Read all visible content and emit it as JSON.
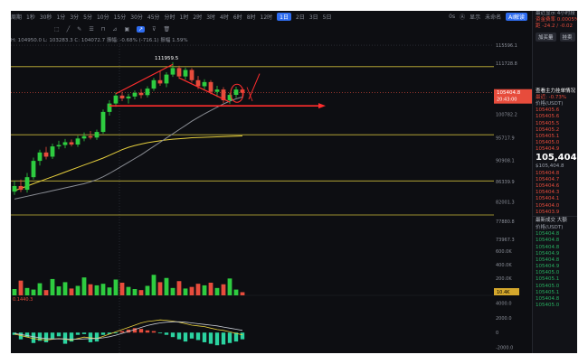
{
  "toolbar": {
    "items": [
      "周期",
      "1秒",
      "30秒",
      "1分",
      "3分",
      "5分",
      "10分",
      "15分",
      "30分",
      "45分",
      "分时",
      "1时",
      "2时",
      "3时",
      "4时",
      "6时",
      "8时",
      "12时",
      "1日",
      "2日",
      "3日",
      "5日"
    ],
    "active_index": 18,
    "right": [
      "0s",
      "Ⓐ",
      "显示",
      "未命名",
      "AI解读"
    ]
  },
  "indicator_info": {
    "text": "H: 104950.0  L: 103283.3  C: 104072.7  振幅: -0.68% (-716.1)  振幅 1.59%"
  },
  "macd_info": {
    "label": "0.1440.3"
  },
  "chart_data": {
    "type": "candlestick",
    "title": "",
    "ylim": [
      73000,
      116000
    ],
    "price_ticks": [
      "115596.1",
      "111728.8",
      "105404.8",
      "100782.2",
      "95717.9",
      "90908.1",
      "86339.9",
      "82001.3",
      "77880.8",
      "73967.3"
    ],
    "price_tick_values": [
      115596.1,
      111728.8,
      105404.8,
      100782.2,
      95717.9,
      90908.1,
      86339.9,
      82001.3,
      77880.8,
      73967.3
    ],
    "last_price": "105404.8",
    "countdown": "20:43:00",
    "peak_label": "111959.5",
    "peak_value": 111959.5,
    "horizontal_levels": [
      111000,
      96400,
      86500,
      79200
    ],
    "candles": [
      {
        "o": 84200,
        "h": 86500,
        "l": 83500,
        "c": 85400
      },
      {
        "o": 85400,
        "h": 86800,
        "l": 84100,
        "c": 84600
      },
      {
        "o": 84600,
        "h": 88200,
        "l": 84000,
        "c": 87300
      },
      {
        "o": 87300,
        "h": 91500,
        "l": 86800,
        "c": 90800
      },
      {
        "o": 90800,
        "h": 93200,
        "l": 89800,
        "c": 92600
      },
      {
        "o": 92600,
        "h": 93800,
        "l": 91100,
        "c": 91700
      },
      {
        "o": 91700,
        "h": 94500,
        "l": 91200,
        "c": 93900
      },
      {
        "o": 93900,
        "h": 95100,
        "l": 93300,
        "c": 94200
      },
      {
        "o": 94200,
        "h": 95500,
        "l": 93500,
        "c": 94800
      },
      {
        "o": 94800,
        "h": 95400,
        "l": 93900,
        "c": 94300
      },
      {
        "o": 94300,
        "h": 96200,
        "l": 93800,
        "c": 95600
      },
      {
        "o": 95600,
        "h": 96900,
        "l": 95000,
        "c": 96100
      },
      {
        "o": 96100,
        "h": 97200,
        "l": 95400,
        "c": 95800
      },
      {
        "o": 95800,
        "h": 97500,
        "l": 95300,
        "c": 97000
      },
      {
        "o": 97000,
        "h": 101800,
        "l": 96600,
        "c": 101300
      },
      {
        "o": 101300,
        "h": 103800,
        "l": 100500,
        "c": 103100
      },
      {
        "o": 103100,
        "h": 105500,
        "l": 102400,
        "c": 104800
      },
      {
        "o": 104800,
        "h": 105600,
        "l": 103600,
        "c": 104200
      },
      {
        "o": 104200,
        "h": 105200,
        "l": 103100,
        "c": 104600
      },
      {
        "o": 104600,
        "h": 105900,
        "l": 104000,
        "c": 105400
      },
      {
        "o": 105400,
        "h": 106200,
        "l": 104200,
        "c": 104900
      },
      {
        "o": 104900,
        "h": 106800,
        "l": 104400,
        "c": 106300
      },
      {
        "o": 106300,
        "h": 108600,
        "l": 105800,
        "c": 108100
      },
      {
        "o": 108100,
        "h": 110200,
        "l": 106900,
        "c": 107400
      },
      {
        "o": 107400,
        "h": 109800,
        "l": 106600,
        "c": 109300
      },
      {
        "o": 109300,
        "h": 111960,
        "l": 108800,
        "c": 110700
      },
      {
        "o": 110700,
        "h": 111200,
        "l": 108400,
        "c": 108900
      },
      {
        "o": 108900,
        "h": 110800,
        "l": 108200,
        "c": 110300
      },
      {
        "o": 110300,
        "h": 110700,
        "l": 107600,
        "c": 108100
      },
      {
        "o": 108100,
        "h": 109000,
        "l": 106200,
        "c": 106800
      },
      {
        "o": 106800,
        "h": 108300,
        "l": 106000,
        "c": 107700
      },
      {
        "o": 107700,
        "h": 108100,
        "l": 105100,
        "c": 105600
      },
      {
        "o": 105600,
        "h": 106900,
        "l": 104500,
        "c": 106100
      },
      {
        "o": 106100,
        "h": 106600,
        "l": 103200,
        "c": 103800
      },
      {
        "o": 103800,
        "h": 105400,
        "l": 103000,
        "c": 104950
      },
      {
        "o": 104950,
        "h": 106700,
        "l": 104300,
        "c": 106100
      },
      {
        "o": 106100,
        "h": 106500,
        "l": 104600,
        "c": 105400
      }
    ],
    "ma_yellow": [
      84400,
      84900,
      85400,
      85900,
      86400,
      86900,
      87400,
      87900,
      88400,
      88900,
      89400,
      89900,
      90400,
      90900,
      91400,
      92000,
      92600,
      93200,
      93700,
      94100,
      94400,
      94700,
      94900,
      95100,
      95300,
      95450,
      95550,
      95650,
      95750,
      95800,
      95850,
      95900,
      95950,
      96000,
      96050,
      96100,
      96150
    ],
    "ma_gray": [
      82600,
      82900,
      83200,
      83500,
      83800,
      84100,
      84400,
      84700,
      85000,
      85300,
      85600,
      85900,
      86300,
      86800,
      87400,
      88100,
      88900,
      89700,
      90500,
      91300,
      92100,
      93000,
      93900,
      94800,
      95700,
      96600,
      97500,
      98400,
      99300,
      100100,
      100900,
      101600,
      102300,
      103000,
      103600,
      104100,
      104500
    ],
    "volume": [
      1.2,
      2.8,
      1.4,
      1.1,
      2.3,
      1.0,
      3.1,
      1.7,
      2.5,
      1.3,
      1.8,
      3.4,
      2.1,
      1.9,
      2.2,
      1.5,
      3.0,
      2.4,
      1.6,
      1.2,
      1.0,
      1.8,
      3.9,
      2.5,
      3.3,
      1.4,
      2.7,
      1.3,
      1.6,
      2.2,
      1.9,
      2.4,
      1.4,
      2.1,
      3.2,
      1.1,
      0.6
    ],
    "volume_ticks": [
      "600.0K",
      "400.0K",
      "200.0K"
    ],
    "volume_label": "10.4K",
    "macd": [
      -300,
      -900,
      -600,
      -1400,
      -1100,
      -1300,
      -800,
      -500,
      -1500,
      -1200,
      -300,
      -200,
      -1300,
      -1200,
      -300,
      -200,
      -100,
      200,
      400,
      600,
      500,
      300,
      200,
      -100,
      -300,
      -600,
      -900,
      -1200,
      -800,
      -1000,
      -1300,
      -1500,
      -1700,
      -1600,
      -1400,
      -1200,
      -900
    ],
    "macd_line_a": [
      -200,
      -400,
      -600,
      -800,
      -900,
      -1000,
      -900,
      -800,
      -900,
      -1000,
      -800,
      -600,
      -700,
      -800,
      -500,
      -200,
      100,
      400,
      700,
      1000,
      1300,
      1500,
      1600,
      1700,
      1650,
      1550,
      1400,
      1200,
      1000,
      900,
      800,
      600,
      400,
      300,
      100,
      -100,
      -300
    ],
    "macd_line_b": [
      -100,
      -250,
      -400,
      -550,
      -700,
      -800,
      -850,
      -850,
      -850,
      -900,
      -900,
      -850,
      -800,
      -800,
      -700,
      -550,
      -350,
      -100,
      150,
      400,
      700,
      950,
      1150,
      1300,
      1400,
      1450,
      1450,
      1400,
      1300,
      1200,
      1100,
      1000,
      900,
      750,
      600,
      450,
      300
    ],
    "macd_ticks": [
      "4000.0",
      "2000.0",
      "0",
      "-2000.0"
    ],
    "macd_tick_values": [
      4000,
      2000,
      0,
      -2000
    ]
  },
  "right_panel": {
    "header_rows": [
      "最近显示 4小时段",
      "资金费率  0.0005%",
      "距 -24.2 / -0.02"
    ],
    "buttons": [
      "加买量",
      "挂卖"
    ],
    "label_main": "查看主力挂单情况 >",
    "change": "最近: -0.73%",
    "price_header": "价格(USDT)",
    "asks": [
      "105405.6",
      "105405.6",
      "105405.5",
      "105405.2",
      "105405.1",
      "105405.0",
      "105404.9"
    ],
    "last": "105,404.8",
    "last_sub": "$105,404.8",
    "bids": [
      "105404.8",
      "105404.7",
      "105404.6",
      "105404.3",
      "105404.1",
      "105404.0",
      "105403.9"
    ],
    "trades_title": "最新成交",
    "trades_tab2": "大额",
    "trades_header": "价格(USDT)",
    "trades": [
      "105404.8",
      "105404.8",
      "105404.8",
      "105404.9",
      "105404.8",
      "105404.9",
      "105405.0",
      "105405.1",
      "105405.0",
      "105405.1",
      "105404.8",
      "105405.0"
    ]
  }
}
